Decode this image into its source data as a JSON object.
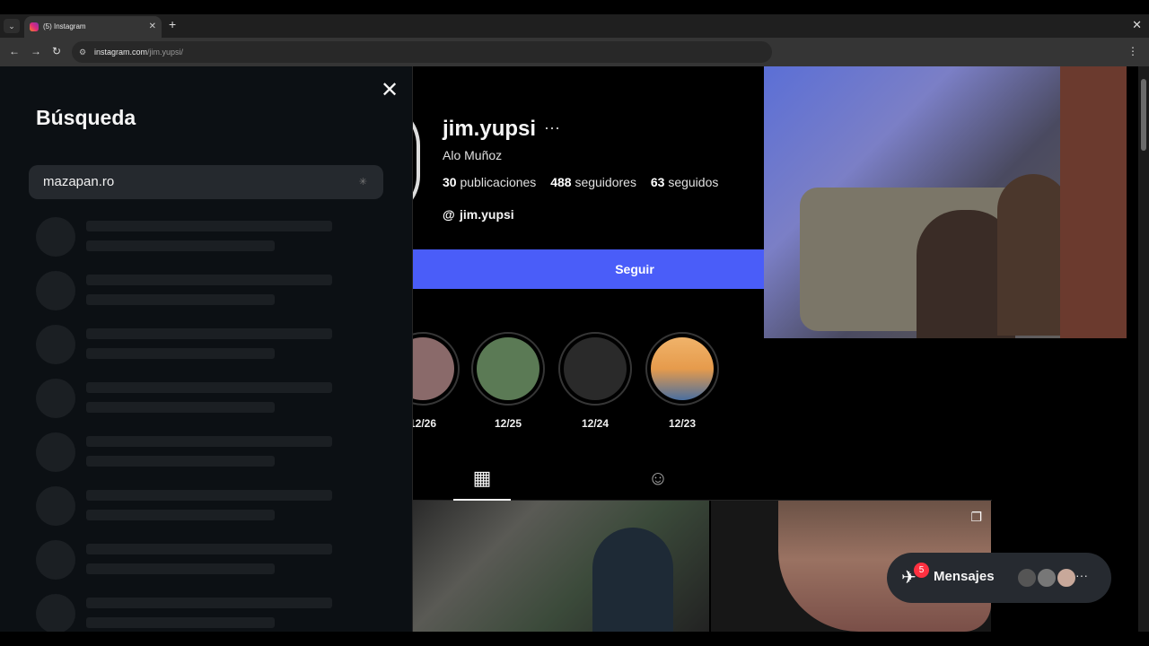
{
  "browser": {
    "tab_title": "(5) Instagram",
    "url_host": "instagram.com",
    "url_path": "/jim.yupsi/",
    "new_tab_symbol": "+",
    "close_symbol": "✕"
  },
  "search": {
    "title": "Búsqueda",
    "query": "mazapan.ro",
    "skeleton_rows": 8
  },
  "profile": {
    "username": "jim.yupsi",
    "more_symbol": "···",
    "full_name": "Alo Muñoz",
    "stats": {
      "posts_count": "30",
      "posts_label": "publicaciones",
      "followers_count": "488",
      "followers_label": "seguidores",
      "following_count": "63",
      "following_label": "seguidos"
    },
    "threads_handle": "jim.yupsi",
    "follow_label": "Seguir",
    "highlights": [
      {
        "label": "12/26",
        "color": "#8a6a6a"
      },
      {
        "label": "12/25",
        "color": "#5b7a55"
      },
      {
        "label": "12/24",
        "color": "#2a2a2a"
      },
      {
        "label": "12/23",
        "color": "#e69b4c"
      }
    ]
  },
  "messages": {
    "label": "Mensajes",
    "badge": "5",
    "more": "···"
  }
}
